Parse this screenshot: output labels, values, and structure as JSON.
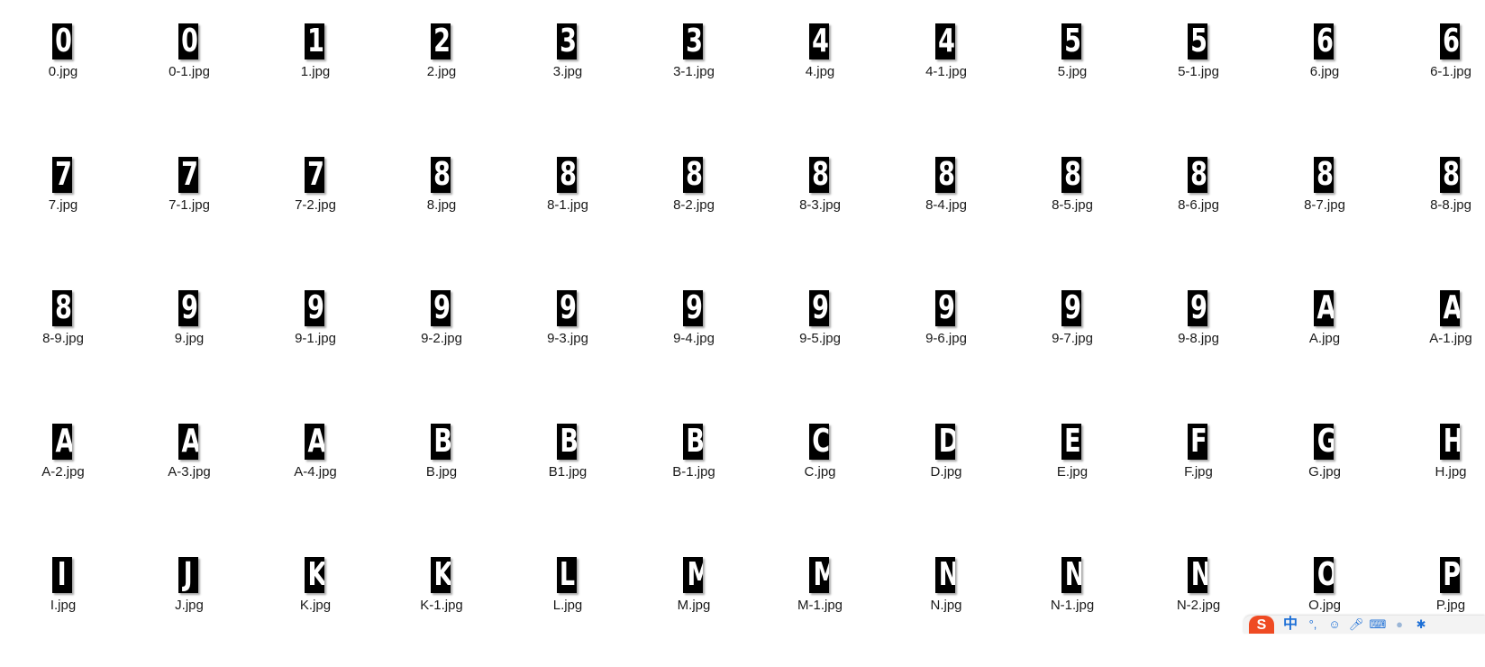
{
  "files": [
    {
      "glyph": "0",
      "name": "0.jpg"
    },
    {
      "glyph": "0",
      "name": "0-1.jpg"
    },
    {
      "glyph": "1",
      "name": "1.jpg"
    },
    {
      "glyph": "2",
      "name": "2.jpg"
    },
    {
      "glyph": "3",
      "name": "3.jpg"
    },
    {
      "glyph": "3",
      "name": "3-1.jpg"
    },
    {
      "glyph": "4",
      "name": "4.jpg"
    },
    {
      "glyph": "4",
      "name": "4-1.jpg"
    },
    {
      "glyph": "5",
      "name": "5.jpg"
    },
    {
      "glyph": "5",
      "name": "5-1.jpg"
    },
    {
      "glyph": "6",
      "name": "6.jpg"
    },
    {
      "glyph": "6",
      "name": "6-1.jpg"
    },
    {
      "glyph": "7",
      "name": "7.jpg"
    },
    {
      "glyph": "7",
      "name": "7-1.jpg"
    },
    {
      "glyph": "7",
      "name": "7-2.jpg"
    },
    {
      "glyph": "8",
      "name": "8.jpg"
    },
    {
      "glyph": "8",
      "name": "8-1.jpg"
    },
    {
      "glyph": "8",
      "name": "8-2.jpg"
    },
    {
      "glyph": "8",
      "name": "8-3.jpg"
    },
    {
      "glyph": "8",
      "name": "8-4.jpg"
    },
    {
      "glyph": "8",
      "name": "8-5.jpg"
    },
    {
      "glyph": "8",
      "name": "8-6.jpg"
    },
    {
      "glyph": "8",
      "name": "8-7.jpg"
    },
    {
      "glyph": "8",
      "name": "8-8.jpg"
    },
    {
      "glyph": "8",
      "name": "8-9.jpg"
    },
    {
      "glyph": "9",
      "name": "9.jpg"
    },
    {
      "glyph": "9",
      "name": "9-1.jpg"
    },
    {
      "glyph": "9",
      "name": "9-2.jpg"
    },
    {
      "glyph": "9",
      "name": "9-3.jpg"
    },
    {
      "glyph": "9",
      "name": "9-4.jpg"
    },
    {
      "glyph": "9",
      "name": "9-5.jpg"
    },
    {
      "glyph": "9",
      "name": "9-6.jpg"
    },
    {
      "glyph": "9",
      "name": "9-7.jpg"
    },
    {
      "glyph": "9",
      "name": "9-8.jpg"
    },
    {
      "glyph": "A",
      "name": "A.jpg"
    },
    {
      "glyph": "A",
      "name": "A-1.jpg"
    },
    {
      "glyph": "A",
      "name": "A-2.jpg"
    },
    {
      "glyph": "A",
      "name": "A-3.jpg"
    },
    {
      "glyph": "A",
      "name": "A-4.jpg"
    },
    {
      "glyph": "B",
      "name": "B.jpg"
    },
    {
      "glyph": "B",
      "name": "B1.jpg"
    },
    {
      "glyph": "B",
      "name": "B-1.jpg"
    },
    {
      "glyph": "C",
      "name": "C.jpg"
    },
    {
      "glyph": "D",
      "name": "D.jpg"
    },
    {
      "glyph": "E",
      "name": "E.jpg"
    },
    {
      "glyph": "F",
      "name": "F.jpg"
    },
    {
      "glyph": "G",
      "name": "G.jpg"
    },
    {
      "glyph": "H",
      "name": "H.jpg"
    },
    {
      "glyph": "I",
      "name": "I.jpg"
    },
    {
      "glyph": "J",
      "name": "J.jpg"
    },
    {
      "glyph": "K",
      "name": "K.jpg"
    },
    {
      "glyph": "K",
      "name": "K-1.jpg"
    },
    {
      "glyph": "L",
      "name": "L.jpg"
    },
    {
      "glyph": "M",
      "name": "M.jpg"
    },
    {
      "glyph": "M",
      "name": "M-1.jpg"
    },
    {
      "glyph": "N",
      "name": "N.jpg"
    },
    {
      "glyph": "N",
      "name": "N-1.jpg"
    },
    {
      "glyph": "N",
      "name": "N-2.jpg"
    },
    {
      "glyph": "O",
      "name": "O.jpg"
    },
    {
      "glyph": "P",
      "name": "P.jpg"
    }
  ],
  "ime_tray": {
    "logo": "S",
    "mode": "中",
    "icons": [
      "punctuation-icon",
      "emoji-icon",
      "microphone-icon",
      "keyboard-icon",
      "user-icon",
      "settings-icon"
    ],
    "brand_color": "#ef4b23",
    "accent_color": "#1d6fd6"
  }
}
